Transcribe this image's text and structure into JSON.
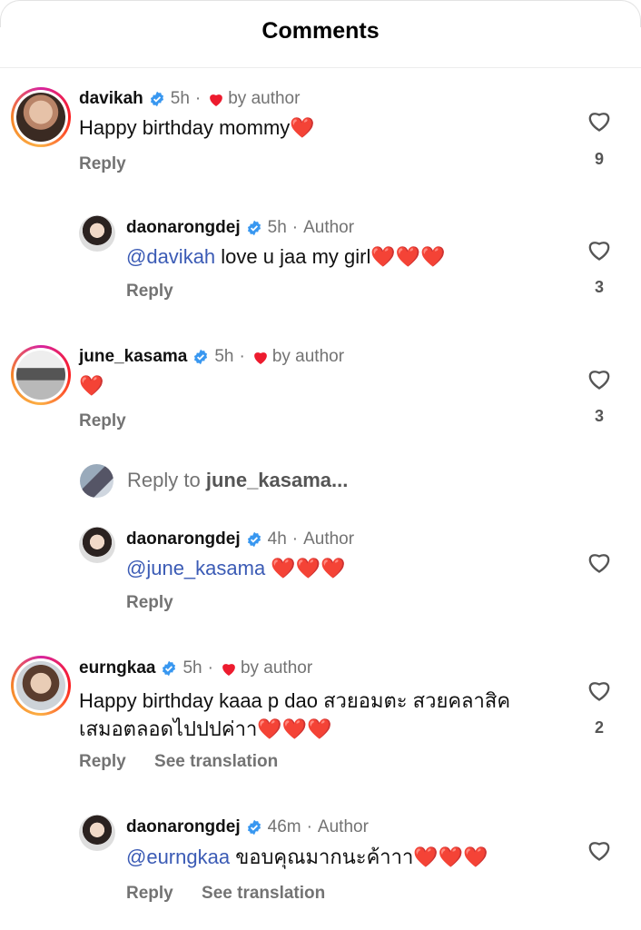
{
  "header": {
    "title": "Comments"
  },
  "comments": [
    {
      "user": "davikah",
      "time": "5h",
      "tag": "by author",
      "text": "Happy birthday mommy",
      "emoji": "❤️",
      "actions": {
        "reply": "Reply"
      },
      "likes": "9"
    },
    {
      "user": "daonarongdej",
      "time": "5h",
      "tag": "Author",
      "mention": "@davikah",
      "text": "love u jaa my girl",
      "emoji": "❤️❤️❤️",
      "actions": {
        "reply": "Reply"
      },
      "likes": "3"
    },
    {
      "user": "june_kasama",
      "time": "5h",
      "tag": "by author",
      "emoji": "❤️",
      "actions": {
        "reply": "Reply"
      },
      "likes": "3"
    },
    {
      "reply_prompt": "Reply to",
      "reply_user": "june_kasama..."
    },
    {
      "user": "daonarongdej",
      "time": "4h",
      "tag": "Author",
      "mention": "@june_kasama",
      "emoji": "❤️❤️❤️",
      "actions": {
        "reply": "Reply"
      }
    },
    {
      "user": "eurngkaa",
      "time": "5h",
      "tag": "by author",
      "text_line1": "Happy birthday kaaa p dao สวยอมตะ สวยคลาสิค",
      "text_line2": "เสมอตลอดไปปปค่าา",
      "emoji": "❤️❤️❤️",
      "actions": {
        "reply": "Reply",
        "translate": "See translation"
      },
      "likes": "2"
    },
    {
      "user": "daonarongdej",
      "time": "46m",
      "tag": "Author",
      "mention": "@eurngkaa",
      "text": "ขอบคุณมากนะค้าาา",
      "emoji": "❤️❤️❤️",
      "actions": {
        "reply": "Reply",
        "translate": "See translation"
      }
    }
  ],
  "colors": {
    "verified": "#3897f0",
    "heart": "#ed1b2e",
    "mention": "#3b5bb5",
    "muted": "#737373"
  },
  "icons": {
    "like": "heart-outline-icon",
    "verified": "verified-badge-icon",
    "liked_by_author": "heart-filled-icon"
  }
}
